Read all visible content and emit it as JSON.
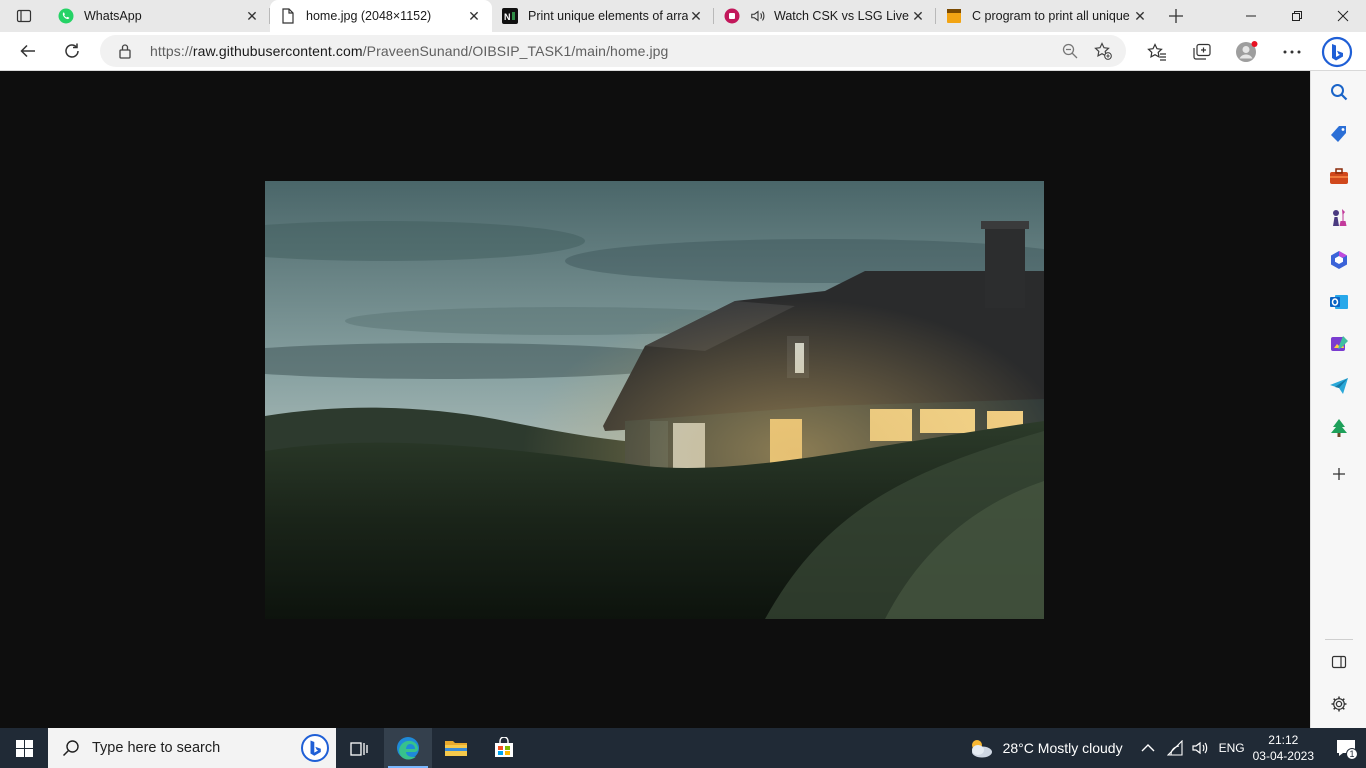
{
  "browser": {
    "tabs": [
      {
        "title": "WhatsApp",
        "icon": "whatsapp-icon"
      },
      {
        "title": "home.jpg (2048×1152)",
        "icon": "page-icon",
        "active": true
      },
      {
        "title": "Print unique elements of arra",
        "icon": "gfg-icon"
      },
      {
        "title": "Watch CSK vs LSG Live M",
        "icon": "jiocinema-icon"
      },
      {
        "title": "C program to print all unique",
        "icon": "tutorial-icon"
      }
    ],
    "address": {
      "prefix": "https://",
      "domain": "raw.githubusercontent.com",
      "path": "/PraveenSunand/OIBSIP_TASK1/main/home.jpg"
    }
  },
  "taskbar": {
    "search_placeholder": "Type here to search",
    "weather": "28°C  Mostly cloudy",
    "language": "ENG",
    "time": "21:12",
    "date": "03-04-2023",
    "notification_count": "1"
  },
  "colors": {
    "accent": "#0078d4",
    "taskbar": "#202a36"
  }
}
